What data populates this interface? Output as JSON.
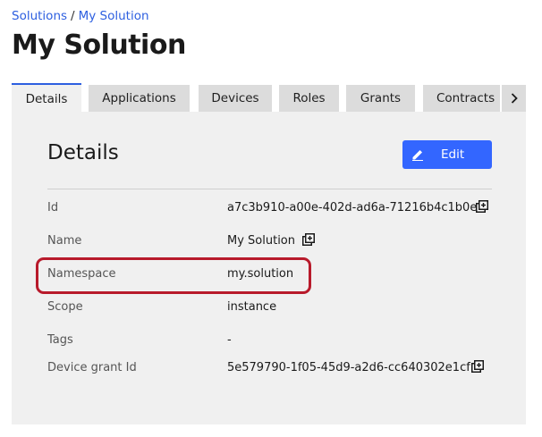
{
  "breadcrumb": {
    "root": "Solutions",
    "separator": "/",
    "current": "My Solution"
  },
  "page": {
    "title": "My Solution"
  },
  "tabs": [
    {
      "label": "Details",
      "active": true
    },
    {
      "label": "Applications",
      "active": false
    },
    {
      "label": "Devices",
      "active": false
    },
    {
      "label": "Roles",
      "active": false
    },
    {
      "label": "Grants",
      "active": false
    },
    {
      "label": "Contracts",
      "active": false
    }
  ],
  "tab_scroll_icon": "chevron-right-icon",
  "details": {
    "title": "Details",
    "edit_label": "Edit",
    "edit_icon": "pencil-icon",
    "rows": [
      {
        "label": "Id",
        "value": "a7c3b910-a00e-402d-ad6a-71216b4c1b0e",
        "copyable": true
      },
      {
        "label": "Name",
        "value": "My Solution",
        "copyable": true
      },
      {
        "label": "Namespace",
        "value": "my.solution",
        "copyable": false,
        "highlighted": true
      },
      {
        "label": "Scope",
        "value": "instance",
        "copyable": false
      },
      {
        "label": "Tags",
        "value": "-",
        "copyable": false
      },
      {
        "label": "Device grant Id",
        "value": "5e579790-1f05-45d9-a2d6-cc640302e1cf",
        "copyable": true
      }
    ]
  },
  "colors": {
    "accent": "#3366ff",
    "link": "#2d5fe0",
    "highlight": "#b81a2b",
    "panel": "#f0f0f0",
    "tab_inactive": "#dcdcdc"
  }
}
